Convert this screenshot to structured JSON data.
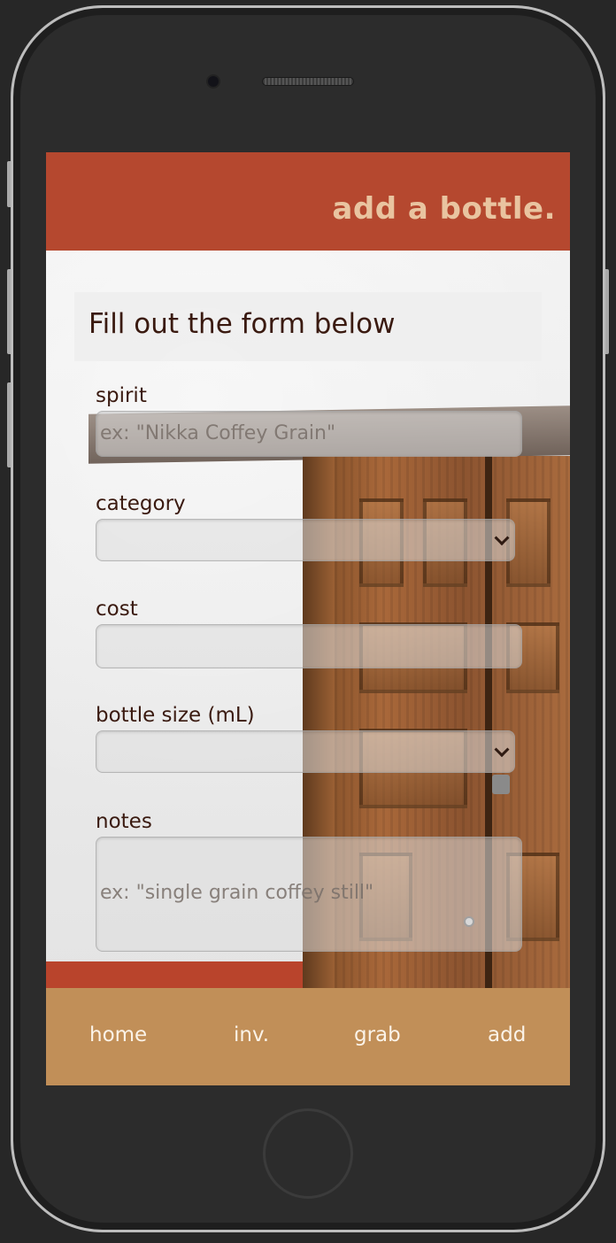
{
  "header": {
    "title": "add a bottle."
  },
  "form": {
    "heading": "Fill out the form below",
    "spirit": {
      "label": "spirit",
      "placeholder": "ex: \"Nikka Coffey Grain\""
    },
    "category": {
      "label": "category",
      "selected": ""
    },
    "cost": {
      "label": "cost",
      "value": ""
    },
    "bottle_size": {
      "label": "bottle size (mL)",
      "selected": ""
    },
    "notes": {
      "label": "notes",
      "placeholder": "ex:  \"single grain coffey still\""
    }
  },
  "nav": {
    "items": [
      {
        "label": "home"
      },
      {
        "label": "inv."
      },
      {
        "label": "grab"
      },
      {
        "label": "add"
      }
    ]
  },
  "colors": {
    "header_bg": "#b5482f",
    "header_text": "#e9c4a0",
    "nav_bg": "#c18f58",
    "nav_text": "#fbf3e8",
    "label_text": "#3a1a10"
  },
  "icons": {
    "select_arrow": "chevron-down-icon"
  }
}
